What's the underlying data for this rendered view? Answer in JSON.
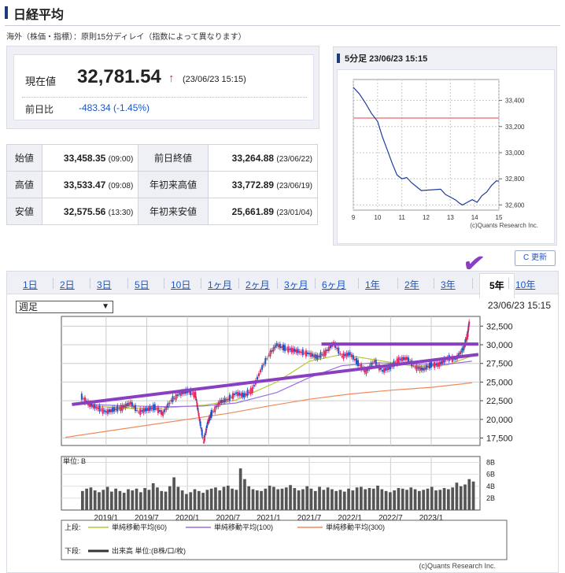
{
  "title": "日経平均",
  "note": "海外（株価・指標）：原則15分ディレイ（指数によって異なります）",
  "price": {
    "current_label": "現在値",
    "current": "32,781.54",
    "arrow": "↑",
    "time": "(23/06/23 15:15)",
    "prev_label": "前日比",
    "change": "-483.34 (-1.45%)"
  },
  "stats": [
    {
      "l1": "始値",
      "v1": "33,458.35",
      "t1": "(09:00)",
      "l2": "前日終値",
      "v2": "33,264.88",
      "t2": "(23/06/22)"
    },
    {
      "l1": "高値",
      "v1": "33,533.47",
      "t1": "(09:08)",
      "l2": "年初来高値",
      "v2": "33,772.89",
      "t2": "(23/06/19)"
    },
    {
      "l1": "安値",
      "v1": "32,575.56",
      "t1": "(13:30)",
      "l2": "年初来安値",
      "v2": "25,661.89",
      "t2": "(23/01/04)"
    }
  ],
  "mini": {
    "header": "5分足 23/06/23 15:15",
    "credit": "(c)Quants Research Inc."
  },
  "refresh": "C 更新",
  "tabs": [
    "1日",
    "2日",
    "3日",
    "5日",
    "10日",
    "1ヶ月",
    "2ヶ月",
    "3ヶ月",
    "6ヶ月",
    "1年",
    "2年",
    "3年",
    "5年",
    "10年"
  ],
  "selected_tab": "5年",
  "dropdown": "週足",
  "timestamp": "23/06/23 15:15",
  "unit_label": "単位: B",
  "legend": {
    "upper": "上段:",
    "ma60": "単純移動平均(60)",
    "ma100": "単純移動平均(100)",
    "ma300": "単純移動平均(300)",
    "lower": "下段:",
    "volume": "出来高 単位:(B株/口/枚)"
  },
  "credit": "(c)Quants Research Inc.",
  "colors": {
    "up": "#e0245e",
    "down": "#1b56c2",
    "ma60": "#b5c93a",
    "ma100": "#9b6ee0",
    "ma300": "#ef8a5a",
    "annot": "#8a3fc0"
  },
  "chart_data": [
    {
      "type": "line",
      "title": "5分足 23/06/23 15:15",
      "x_ticks": [
        "9",
        "10",
        "11",
        "12",
        "13",
        "14",
        "15"
      ],
      "y_ticks": [
        32600,
        32800,
        33000,
        33200,
        33400
      ],
      "ylim": [
        32560,
        33560
      ],
      "reference_line": 33264.88,
      "x": [
        9.0,
        9.1,
        9.25,
        9.5,
        9.75,
        10.0,
        10.2,
        10.4,
        10.6,
        10.8,
        11.0,
        11.2,
        11.4,
        11.6,
        11.8,
        12.6,
        12.8,
        13.0,
        13.2,
        13.4,
        13.5,
        13.7,
        13.9,
        14.1,
        14.3,
        14.5,
        14.7,
        14.9,
        15.0
      ],
      "y": [
        33500,
        33480,
        33450,
        33380,
        33300,
        33240,
        33120,
        33020,
        32920,
        32830,
        32800,
        32810,
        32770,
        32740,
        32710,
        32720,
        32680,
        32660,
        32640,
        32610,
        32600,
        32620,
        32640,
        32620,
        32670,
        32700,
        32750,
        32785,
        32781
      ]
    },
    {
      "type": "candlestick",
      "title": "",
      "x_ticks": [
        "2019/1",
        "2019/7",
        "2020/1",
        "2020/7",
        "2021/1",
        "2021/7",
        "2022/1",
        "2022/7",
        "2023/1"
      ],
      "y_ticks": [
        17500,
        20000,
        22500,
        25000,
        27500,
        30000,
        32500
      ],
      "ylim": [
        16500,
        33800
      ],
      "series": [
        {
          "name": "単純移動平均(60)",
          "type": "line",
          "x": [
            2018.8,
            2019.3,
            2019.8,
            2020.2,
            2020.6,
            2021.1,
            2021.5,
            2021.9,
            2022.3,
            2022.8,
            2023.2,
            2023.5
          ],
          "values": [
            21800,
            21500,
            21600,
            21900,
            22600,
            25000,
            27800,
            28700,
            28000,
            27100,
            27300,
            28500
          ]
        },
        {
          "name": "単純移動平均(100)",
          "type": "line",
          "x": [
            2018.8,
            2019.3,
            2019.8,
            2020.2,
            2020.6,
            2021.1,
            2021.5,
            2021.9,
            2022.3,
            2022.8,
            2023.2,
            2023.5
          ],
          "values": [
            22000,
            21800,
            21700,
            21800,
            22200,
            23600,
            25600,
            27200,
            27600,
            27400,
            27400,
            27800
          ]
        },
        {
          "name": "単純移動平均(300)",
          "type": "line",
          "x": [
            2018.5,
            2019.0,
            2019.5,
            2020.0,
            2020.5,
            2021.0,
            2021.5,
            2022.0,
            2022.5,
            2023.0,
            2023.5
          ],
          "values": [
            17600,
            18400,
            19200,
            20000,
            20800,
            21800,
            22700,
            23400,
            23900,
            24300,
            24900
          ]
        },
        {
          "name": "price",
          "type": "candle",
          "x": [
            2018.7,
            2018.8,
            2018.9,
            2019.0,
            2019.1,
            2019.2,
            2019.3,
            2019.4,
            2019.5,
            2019.6,
            2019.7,
            2019.8,
            2019.9,
            2020.0,
            2020.1,
            2020.15,
            2020.2,
            2020.25,
            2020.3,
            2020.4,
            2020.5,
            2020.6,
            2020.7,
            2020.8,
            2020.9,
            2021.0,
            2021.1,
            2021.2,
            2021.3,
            2021.4,
            2021.5,
            2021.6,
            2021.7,
            2021.8,
            2021.9,
            2022.0,
            2022.1,
            2022.2,
            2022.3,
            2022.4,
            2022.5,
            2022.6,
            2022.7,
            2022.8,
            2022.9,
            2023.0,
            2023.1,
            2023.2,
            2023.3,
            2023.4,
            2023.45,
            2023.47
          ],
          "values": [
            23000,
            22000,
            21500,
            21000,
            21300,
            21600,
            22200,
            21000,
            21300,
            21600,
            20800,
            22500,
            23400,
            23800,
            23300,
            20000,
            17000,
            19500,
            20800,
            22300,
            22700,
            23500,
            23200,
            24000,
            26500,
            28600,
            30000,
            29500,
            29300,
            29000,
            28800,
            28300,
            29000,
            30200,
            28500,
            28800,
            27500,
            26400,
            27800,
            26500,
            27000,
            28000,
            28200,
            27000,
            26700,
            27300,
            27400,
            28200,
            28100,
            29500,
            31500,
            33300
          ]
        }
      ]
    },
    {
      "type": "bar",
      "title": "",
      "ylabel": "単位: B",
      "y_ticks": [
        2,
        4,
        6,
        8
      ],
      "ylim": [
        0,
        9
      ],
      "values": [
        3.2,
        3.6,
        3.8,
        3.3,
        3.0,
        3.4,
        3.9,
        3.1,
        3.6,
        3.2,
        2.9,
        3.5,
        3.3,
        3.6,
        3.0,
        3.7,
        3.4,
        4.5,
        3.8,
        3.2,
        3.1,
        4.0,
        5.5,
        3.9,
        3.3,
        2.7,
        3.0,
        3.5,
        3.2,
        2.9,
        3.4,
        3.6,
        3.8,
        3.3,
        3.9,
        4.1,
        3.6,
        3.4,
        7.0,
        5.2,
        4.0,
        3.5,
        3.3,
        3.2,
        3.6,
        4.1,
        3.9,
        3.5,
        3.6,
        3.8,
        4.2,
        3.7,
        3.3,
        3.5,
        4.0,
        3.6,
        3.2,
        3.9,
        3.4,
        3.8,
        3.5,
        3.2,
        3.4,
        3.1,
        3.6,
        3.3,
        3.8,
        3.9,
        3.5,
        3.7,
        3.6,
        4.1,
        3.5,
        3.2,
        3.0,
        3.3,
        3.7,
        3.6,
        3.4,
        3.8,
        3.5,
        3.2,
        3.4,
        3.6,
        3.9,
        3.3,
        3.4,
        3.7,
        3.5,
        3.8,
        4.6,
        4.0,
        4.3,
        5.2,
        4.8
      ]
    }
  ]
}
